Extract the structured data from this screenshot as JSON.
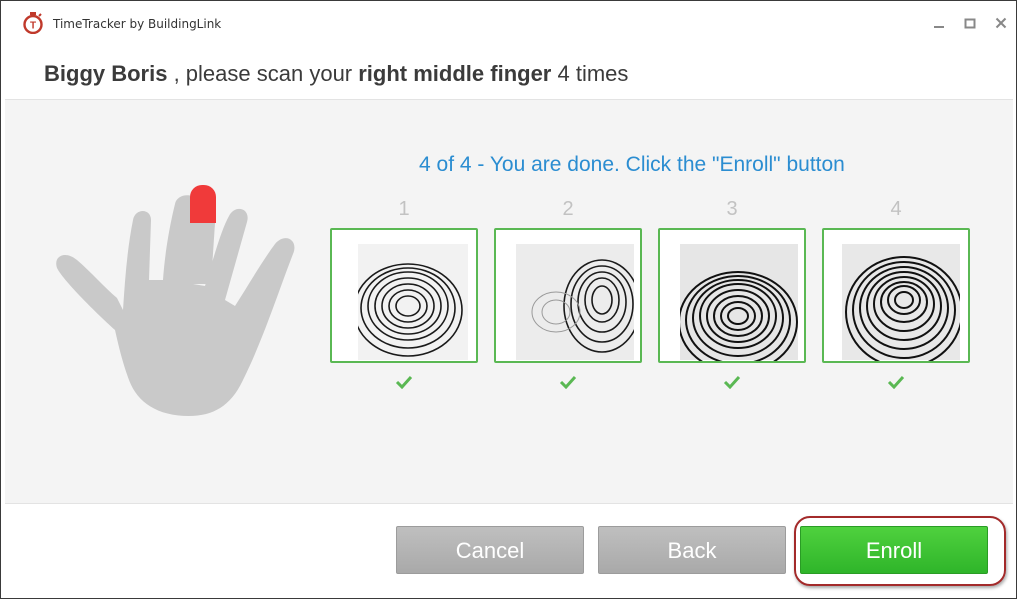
{
  "window": {
    "title": "TimeTracker by BuildingLink"
  },
  "header": {
    "user_name": "Biggy Boris",
    "prompt_middle": " , please scan your ",
    "finger": "right middle finger",
    "prompt_end": " 4 times"
  },
  "hand": {
    "highlighted_finger": "middle",
    "highlight_color": "#f03a3a",
    "hand_color": "#c9c9c9"
  },
  "status": {
    "message": "4 of 4 - You are done. Click the \"Enroll\" button",
    "color": "#2b8dd1"
  },
  "scans": [
    {
      "number": "1",
      "status": "accepted"
    },
    {
      "number": "2",
      "status": "accepted"
    },
    {
      "number": "3",
      "status": "accepted"
    },
    {
      "number": "4",
      "status": "accepted"
    }
  ],
  "footer": {
    "cancel_label": "Cancel",
    "back_label": "Back",
    "enroll_label": "Enroll"
  },
  "colors": {
    "accept_green": "#5ab853",
    "enroll_green": "#3dc232",
    "highlight_ring": "#a32a2a"
  }
}
